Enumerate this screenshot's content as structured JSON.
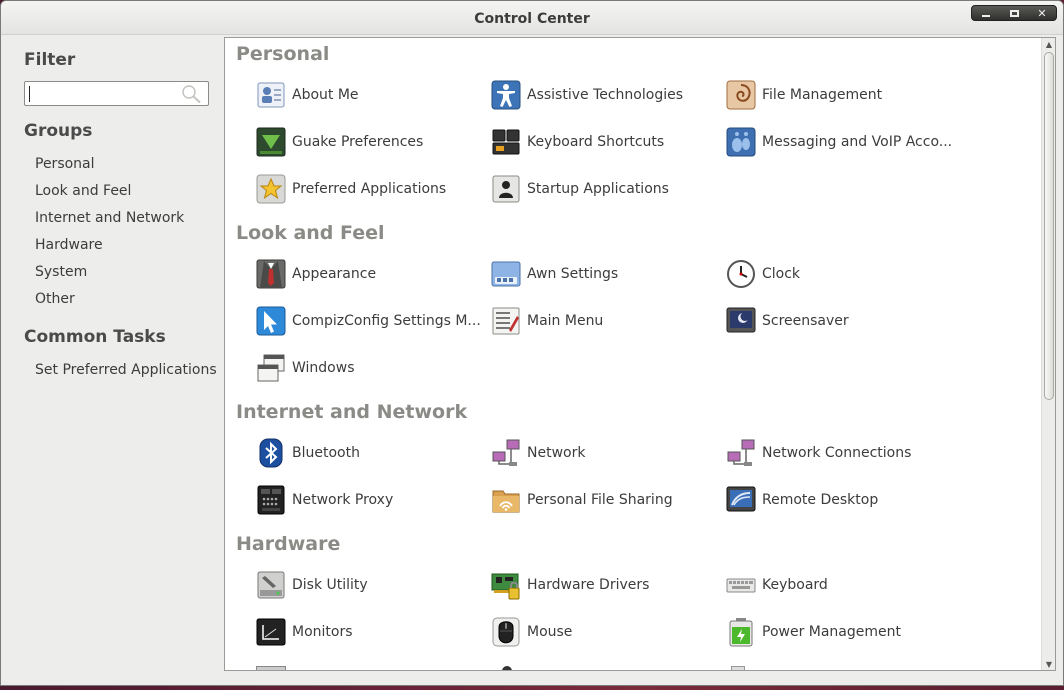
{
  "window": {
    "title": "Control Center"
  },
  "sidebar": {
    "filter_heading": "Filter",
    "search": {
      "value": "",
      "placeholder": ""
    },
    "groups_heading": "Groups",
    "groups": [
      "Personal",
      "Look and Feel",
      "Internet and Network",
      "Hardware",
      "System",
      "Other"
    ],
    "tasks_heading": "Common Tasks",
    "tasks": [
      "Set Preferred Applications"
    ]
  },
  "sections": [
    {
      "title": "Personal",
      "items": [
        {
          "label": "About Me",
          "icon": "about-me-icon"
        },
        {
          "label": "Assistive Technologies",
          "icon": "accessibility-icon"
        },
        {
          "label": "File Management",
          "icon": "file-management-icon"
        },
        {
          "label": "Guake Preferences",
          "icon": "guake-icon"
        },
        {
          "label": "Keyboard Shortcuts",
          "icon": "keyboard-shortcuts-icon"
        },
        {
          "label": "Messaging and VoIP Acco...",
          "icon": "messaging-icon"
        },
        {
          "label": "Preferred Applications",
          "icon": "preferred-apps-icon"
        },
        {
          "label": "Startup Applications",
          "icon": "startup-apps-icon"
        }
      ]
    },
    {
      "title": "Look and Feel",
      "items": [
        {
          "label": "Appearance",
          "icon": "appearance-icon"
        },
        {
          "label": "Awn Settings",
          "icon": "awn-icon"
        },
        {
          "label": "Clock",
          "icon": "clock-icon"
        },
        {
          "label": "CompizConfig Settings M...",
          "icon": "compiz-icon"
        },
        {
          "label": "Main Menu",
          "icon": "main-menu-icon"
        },
        {
          "label": "Screensaver",
          "icon": "screensaver-icon"
        },
        {
          "label": "Windows",
          "icon": "windows-icon"
        }
      ]
    },
    {
      "title": "Internet and Network",
      "items": [
        {
          "label": "Bluetooth",
          "icon": "bluetooth-icon"
        },
        {
          "label": "Network",
          "icon": "network-icon"
        },
        {
          "label": "Network Connections",
          "icon": "network-connections-icon"
        },
        {
          "label": "Network Proxy",
          "icon": "network-proxy-icon"
        },
        {
          "label": "Personal File Sharing",
          "icon": "file-sharing-icon"
        },
        {
          "label": "Remote Desktop",
          "icon": "remote-desktop-icon"
        }
      ]
    },
    {
      "title": "Hardware",
      "items": [
        {
          "label": "Disk Utility",
          "icon": "disk-utility-icon"
        },
        {
          "label": "Hardware Drivers",
          "icon": "hardware-drivers-icon"
        },
        {
          "label": "Keyboard",
          "icon": "keyboard-icon"
        },
        {
          "label": "Monitors",
          "icon": "monitors-icon"
        },
        {
          "label": "Mouse",
          "icon": "mouse-icon"
        },
        {
          "label": "Power Management",
          "icon": "power-management-icon"
        }
      ]
    }
  ]
}
